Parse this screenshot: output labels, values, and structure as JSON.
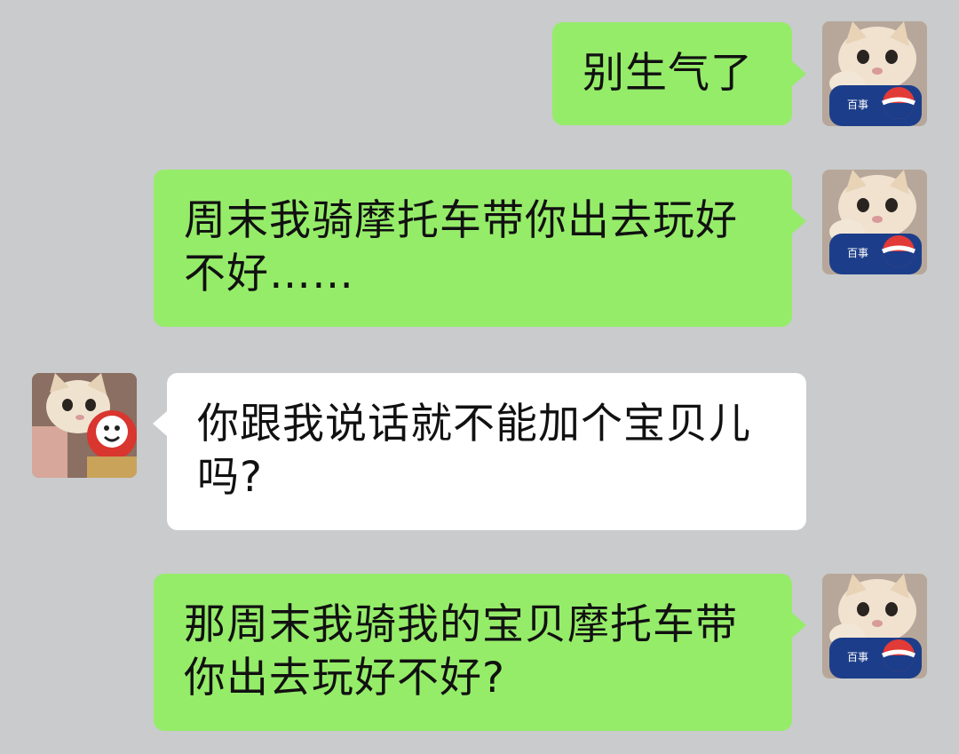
{
  "messages": [
    {
      "id": "m1",
      "side": "outgoing",
      "text": "别生气了",
      "avatar": "cat-with-pepsi-can-avatar"
    },
    {
      "id": "m2",
      "side": "outgoing",
      "text": "周末我骑摩托车带你出去玩好不好……",
      "avatar": "cat-with-pepsi-can-avatar"
    },
    {
      "id": "m3",
      "side": "incoming",
      "text": "你跟我说话就不能加个宝贝儿吗?",
      "avatar": "cat-with-toy-avatar"
    },
    {
      "id": "m4",
      "side": "outgoing",
      "text": "那周末我骑我的宝贝摩托车带你出去玩好不好?",
      "avatar": "cat-with-pepsi-can-avatar"
    }
  ],
  "colors": {
    "background": "#c9cbcc",
    "outgoing_bubble": "#95ec69",
    "incoming_bubble": "#ffffff"
  }
}
